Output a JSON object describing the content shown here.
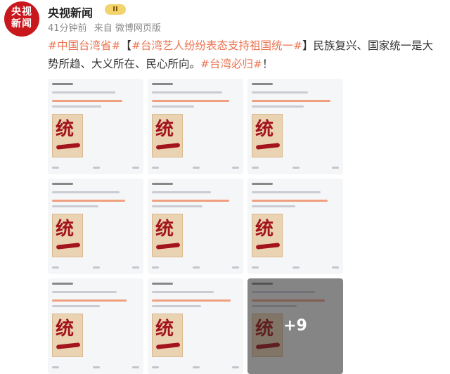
{
  "account": {
    "avatar_lines": [
      "央视",
      "新闻"
    ],
    "name": "央视新闻",
    "badge": "II",
    "time": "41分钟前",
    "source": "来自 微博网页版"
  },
  "post": {
    "t1": "#中国台湾省#",
    "t2": "【",
    "t3": "#台湾艺人纷纷表态支持祖国统一#",
    "t4": "】民族复兴、国家统一是大势所趋、大义所在、民心所向。",
    "t5": "#台湾必归#",
    "t6": "！"
  },
  "images": {
    "glyph": "统",
    "more_label": "+9"
  },
  "colors": {
    "brand": "#c8171d",
    "topic": "#eb7350",
    "poster": "#a3141b"
  }
}
